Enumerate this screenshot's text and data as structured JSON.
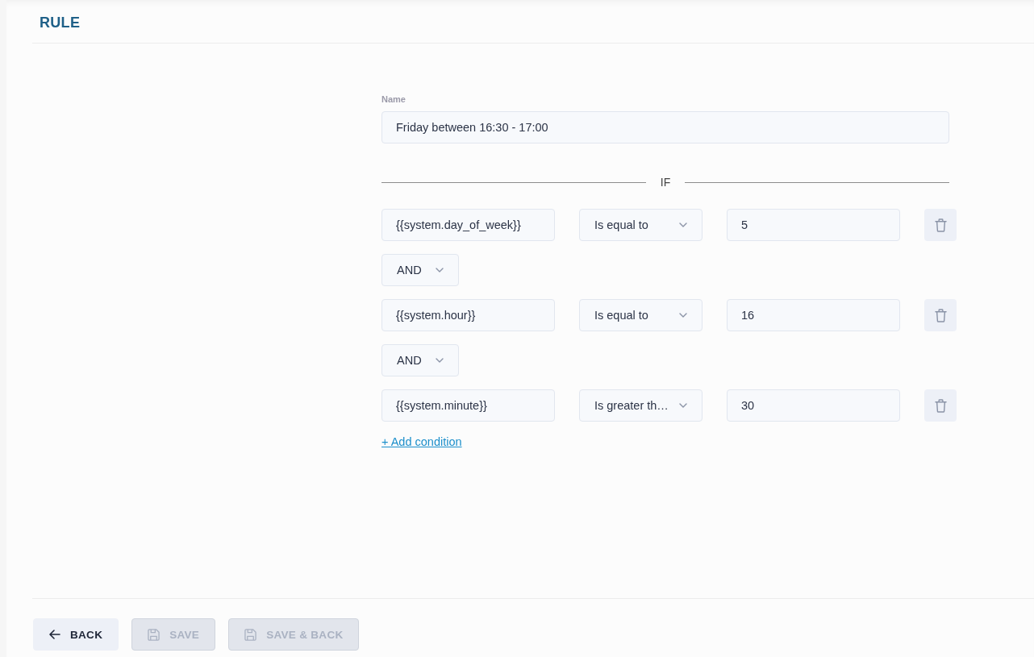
{
  "header": {
    "title": "RULE"
  },
  "name_field": {
    "label": "Name",
    "value": "Friday between 16:30 - 17:00"
  },
  "section_label": "IF",
  "rows": [
    {
      "kind": "condition",
      "variable": "{{system.day_of_week}}",
      "operator": "Is equal to",
      "value": "5"
    },
    {
      "kind": "connector",
      "operator": "AND"
    },
    {
      "kind": "condition",
      "variable": "{{system.hour}}",
      "operator": "Is equal to",
      "value": "16"
    },
    {
      "kind": "connector",
      "operator": "AND"
    },
    {
      "kind": "condition",
      "variable": "{{system.minute}}",
      "operator": "Is greater th…",
      "value": "30"
    }
  ],
  "add_condition_link": "+ Add condition",
  "footer_buttons": [
    {
      "kind": "back",
      "label": "BACK",
      "disabled": false
    },
    {
      "kind": "save",
      "label": "SAVE",
      "disabled": true
    },
    {
      "kind": "save",
      "label": "SAVE & BACK",
      "disabled": true
    }
  ]
}
